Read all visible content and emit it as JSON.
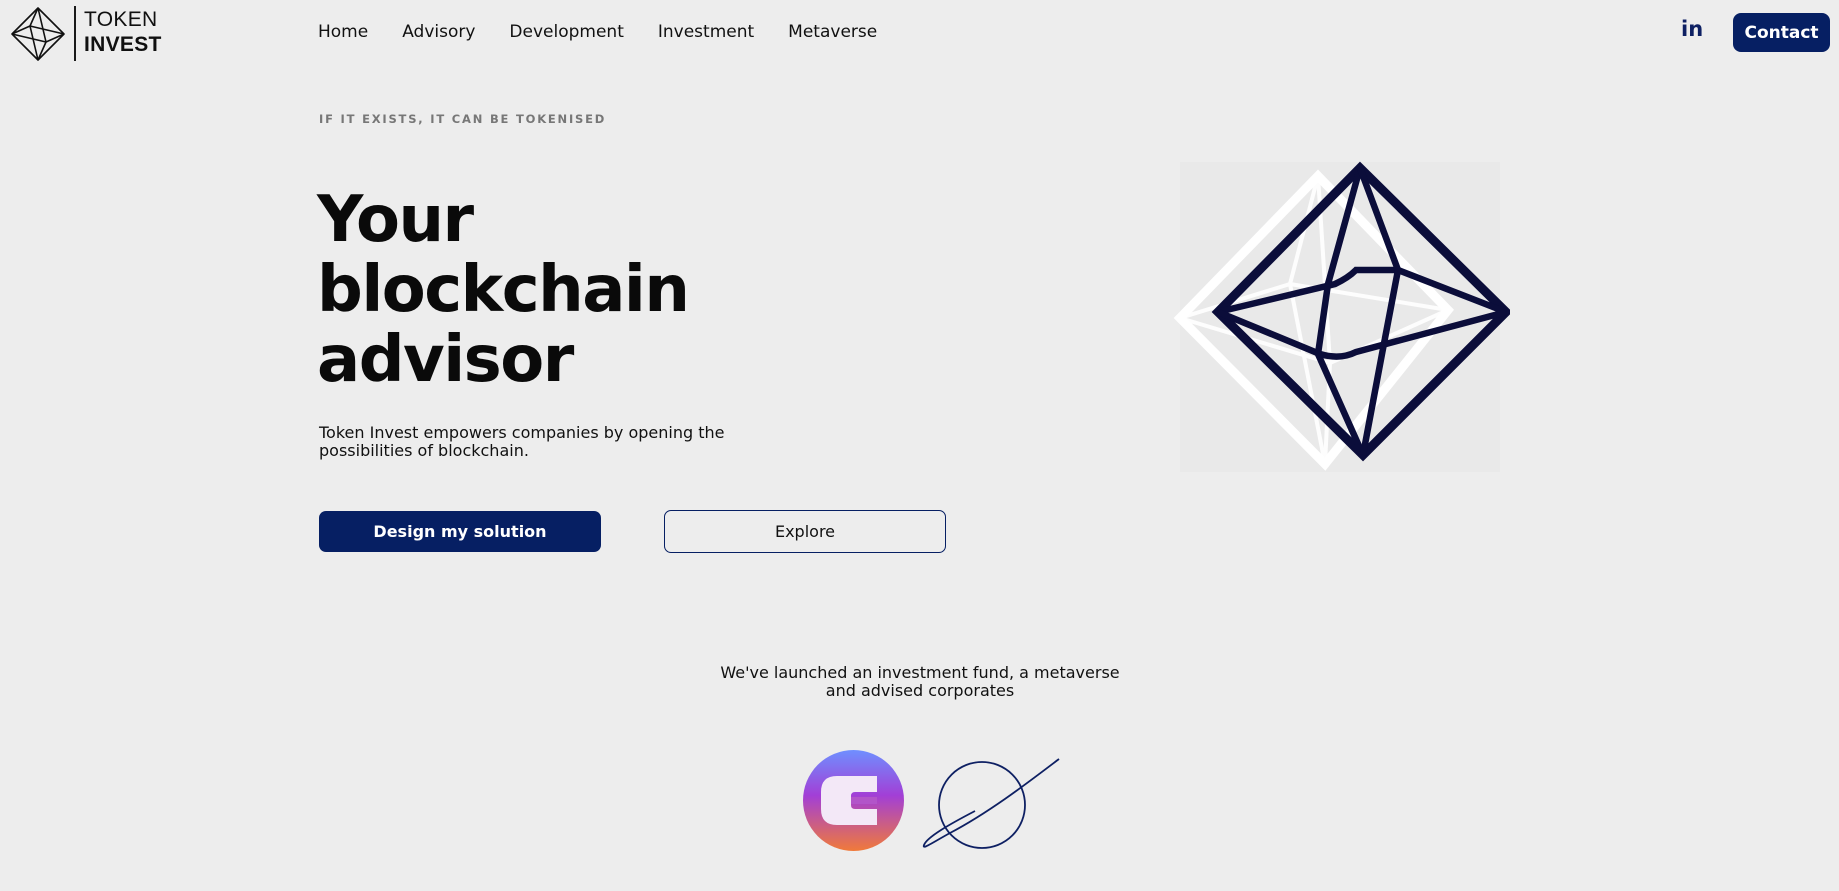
{
  "brand": {
    "name_line1": "TOKEN",
    "name_line2": "INVEST"
  },
  "nav": {
    "items": [
      {
        "label": "Home"
      },
      {
        "label": "Advisory"
      },
      {
        "label": "Development"
      },
      {
        "label": "Investment"
      },
      {
        "label": "Metaverse"
      }
    ],
    "linkedin_label": "in",
    "contact_label": "Contact"
  },
  "hero": {
    "tagline": "IF IT EXISTS, IT CAN BE TOKENISED",
    "title_lines": [
      "Your",
      "blockchain",
      "advisor"
    ],
    "description": "Token Invest empowers companies by opening the possibilities of blockchain.",
    "primary_button": "Design my solution",
    "secondary_button": "Explore"
  },
  "launches": {
    "text_line1": "We've launched an investment fund, a metaverse",
    "text_line2": "and advised corporates"
  },
  "colors": {
    "background": "#ededed",
    "accent": "#061f63",
    "text": "#0b0b0b",
    "muted": "#777777"
  },
  "icons": {
    "logo": "octahedron-logo-icon",
    "linkedin": "linkedin-icon",
    "hero": "octahedron-graphic",
    "partner_1": "e-gradient-logo",
    "partner_2": "planet-orbit-logo"
  }
}
